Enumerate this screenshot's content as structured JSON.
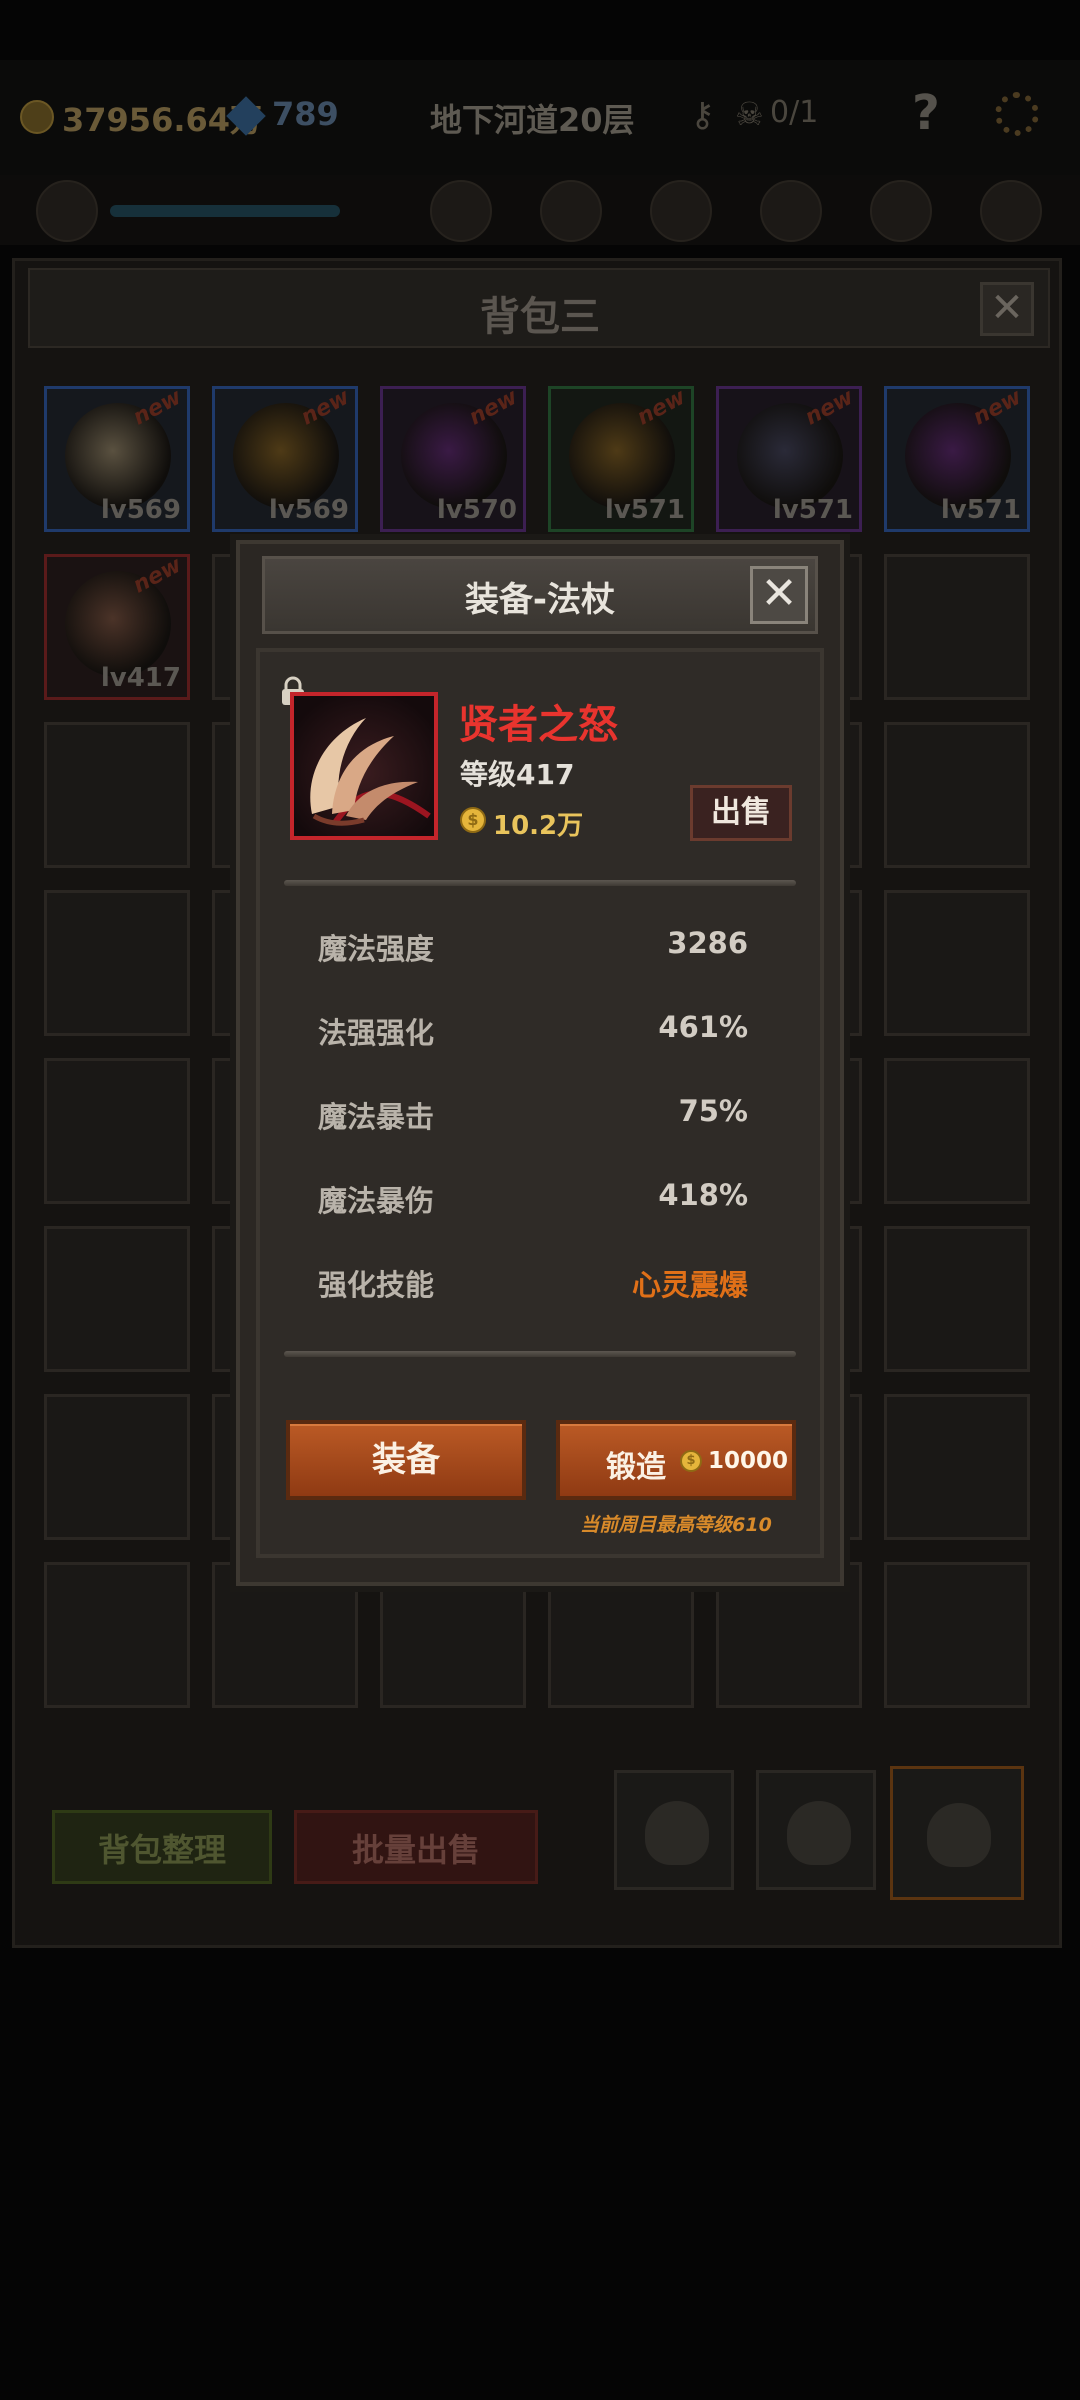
{
  "topbar": {
    "gold": "37956.64万",
    "gems": "789",
    "stage_title": "地下河道20层",
    "runs": "0/1",
    "help_icon": "?"
  },
  "bag": {
    "title": "背包三",
    "close_label": "✕",
    "sort_button": "背包整理",
    "bulk_sell_button": "批量出售",
    "items": [
      {
        "level": "lv569",
        "new_tag": "new",
        "rarity": "blue",
        "icon": "ring-icon",
        "color": "#5a5140"
      },
      {
        "level": "lv569",
        "new_tag": "new",
        "rarity": "blue",
        "icon": "cloak-icon",
        "color": "#4e3a16"
      },
      {
        "level": "lv570",
        "new_tag": "new",
        "rarity": "purple",
        "icon": "orb-icon",
        "color": "#3a1a45"
      },
      {
        "level": "lv571",
        "new_tag": "new",
        "rarity": "green",
        "icon": "cloak-icon",
        "color": "#4e3a16"
      },
      {
        "level": "lv571",
        "new_tag": "new",
        "rarity": "purple",
        "icon": "amulet-icon",
        "color": "#2a2a38"
      },
      {
        "level": "lv571",
        "new_tag": "new",
        "rarity": "blue",
        "icon": "orb-icon",
        "color": "#3a1a45"
      },
      {
        "level": "lv417",
        "new_tag": "new",
        "rarity": "red",
        "icon": "staff-claw-icon",
        "color": "#4b3328"
      }
    ]
  },
  "modal": {
    "title": "装备-法杖",
    "close_label": "✕",
    "item": {
      "name": "贤者之怒",
      "level": "等级417",
      "price": "10.2万",
      "coin_symbol": "$",
      "sell_label": "出售",
      "rarity_color": "#c4252b"
    },
    "stats": [
      {
        "label": "魔法强度",
        "value": "3286"
      },
      {
        "label": "法强强化",
        "value": "461%"
      },
      {
        "label": "魔法暴击",
        "value": "75%"
      },
      {
        "label": "魔法暴伤",
        "value": "418%"
      },
      {
        "label": "强化技能",
        "value": "心灵震爆"
      }
    ],
    "equip_label": "装备",
    "forge_label": "锻造",
    "forge_cost": "10000",
    "max_level_note": "当前周目最高等级610"
  },
  "colors": {
    "accent_orange": "#e07018",
    "item_name_red": "#e8342e",
    "gold_text": "#e9c45c"
  }
}
